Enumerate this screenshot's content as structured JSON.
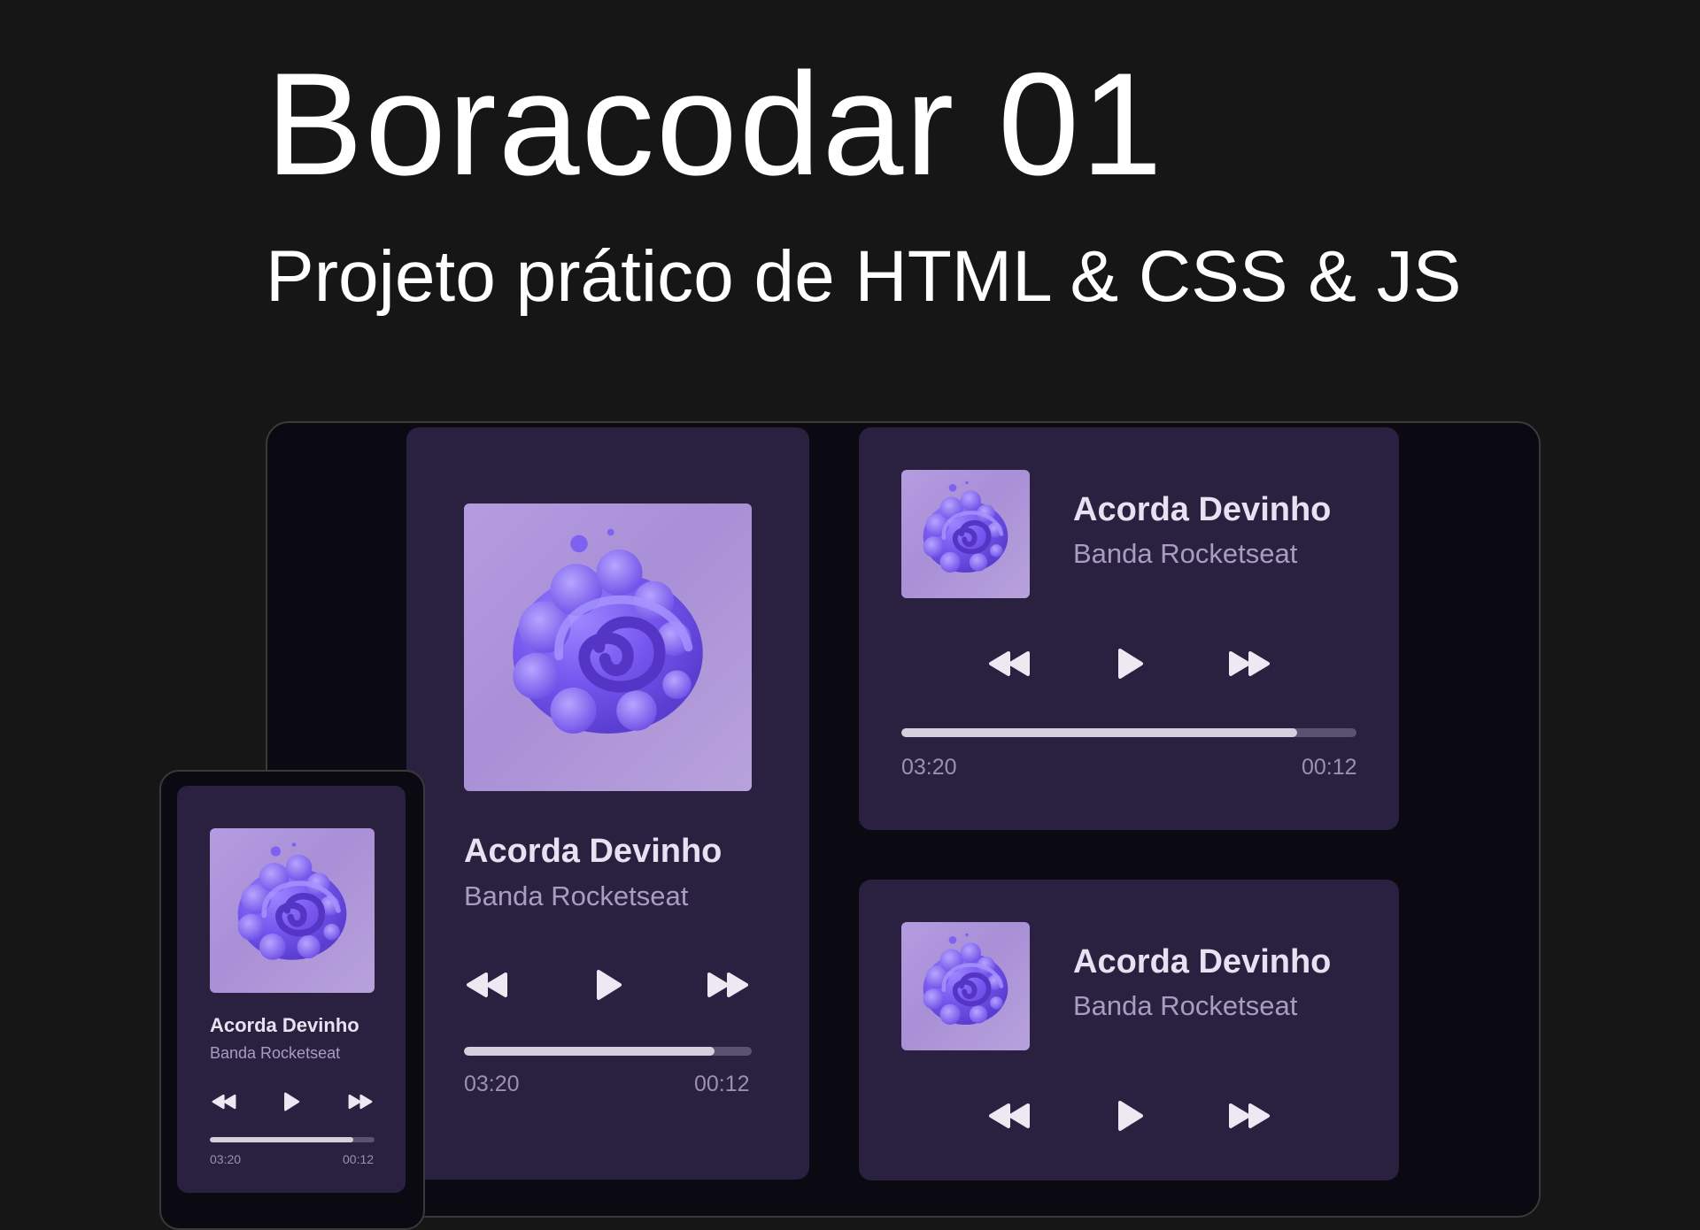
{
  "header": {
    "title": "Boracodar 01",
    "subtitle": "Projeto prático de HTML & CSS & JS"
  },
  "player": {
    "song": "Acorda Devinho",
    "artist": "Banda Rocketseat",
    "elapsed": "03:20",
    "remaining": "00:12",
    "progress_large": 0.87,
    "progress_horizontal": 0.87,
    "progress_mobile": 0.87,
    "controls": [
      "rewind-icon",
      "play-icon",
      "fast-forward-icon"
    ]
  },
  "colors": {
    "background": "#161616",
    "device": "#0b0a12",
    "card": "#2a2141",
    "cover": "#b59be0",
    "accent": "#7b5cf0",
    "title": "#e7e2f2",
    "muted": "#a99dbf"
  }
}
